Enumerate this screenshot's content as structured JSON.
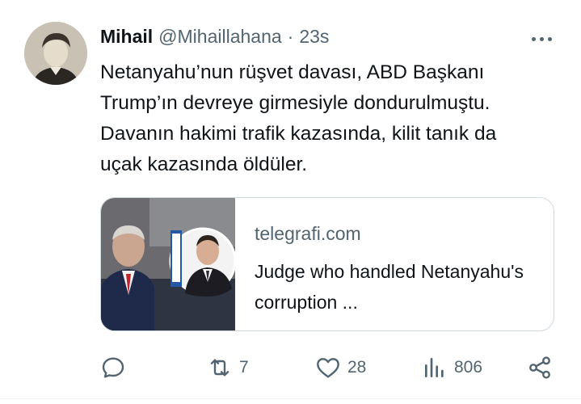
{
  "tweet": {
    "author_name": "Mihail",
    "author_handle": "@Mihaillahana",
    "separator": "·",
    "time": "23s",
    "text": "Netanyahu’nun rüşvet davası, ABD Başkanı\nTrump’ın devreye girmesiyle dondurulmuştu.\nDavanın hakimi trafik kazasında, kilit tanık da\nuçak kazasında öldüler.",
    "card": {
      "domain": "telegrafi.com",
      "title": "Judge who handled Netanyahu's corruption ..."
    },
    "actions": {
      "reply_icon": "reply-icon",
      "retweet_icon": "retweet-icon",
      "retweet_count": "7",
      "like_icon": "heart-icon",
      "like_count": "28",
      "views_icon": "views-icon",
      "views_count": "806",
      "share_icon": "share-icon"
    }
  },
  "colors": {
    "text": "#0f1419",
    "secondary": "#536471",
    "border": "#cfd9de"
  }
}
